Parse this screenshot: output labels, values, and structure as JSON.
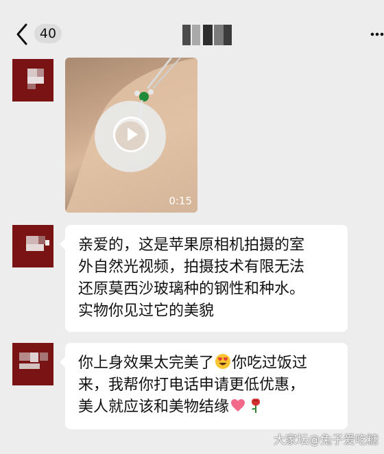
{
  "header": {
    "unread_count": "40",
    "title": ""
  },
  "messages": [
    {
      "type": "video",
      "duration": "0:15"
    },
    {
      "type": "text",
      "lines": [
        "亲爱的，这是苹果原相机拍摄的室",
        "外自然光视频，拍摄技术有限无法",
        "还原莫西沙玻璃种的钢性和种水。",
        "实物你见过它的美貌"
      ]
    },
    {
      "type": "text",
      "lines": [
        "你上身效果太完美了",
        "你吃过饭过",
        "来，我帮你打电话申请更低优惠，",
        "美人就应该和美物结缘"
      ],
      "emojis": [
        "heart-eyes-emoji",
        "heart-emoji",
        "rose-emoji"
      ]
    }
  ],
  "watermark": "大家坛@兔子爱吃糖",
  "colors": {
    "background": "#ededed",
    "bubble": "#ffffff",
    "avatar": "#7a1414"
  }
}
